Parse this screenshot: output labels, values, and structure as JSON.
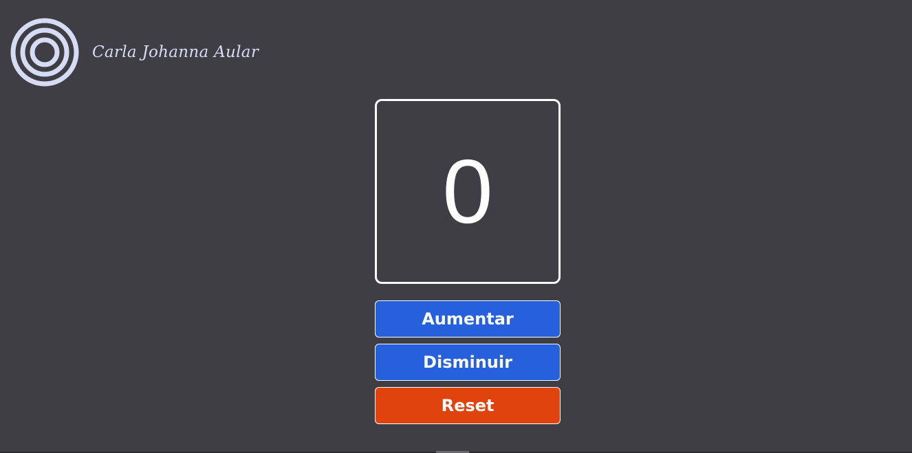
{
  "header": {
    "logo_icon": "concentric-circles-icon",
    "brand_name": "Carla Johanna Aular",
    "logo_color": "#d7dcf5"
  },
  "counter": {
    "value": "0"
  },
  "buttons": {
    "increase_label": "Aumentar",
    "decrease_label": "Disminuir",
    "reset_label": "Reset",
    "primary_color": "#2660dd",
    "reset_color": "#e0430d"
  },
  "theme": {
    "background": "#3f3e44"
  }
}
